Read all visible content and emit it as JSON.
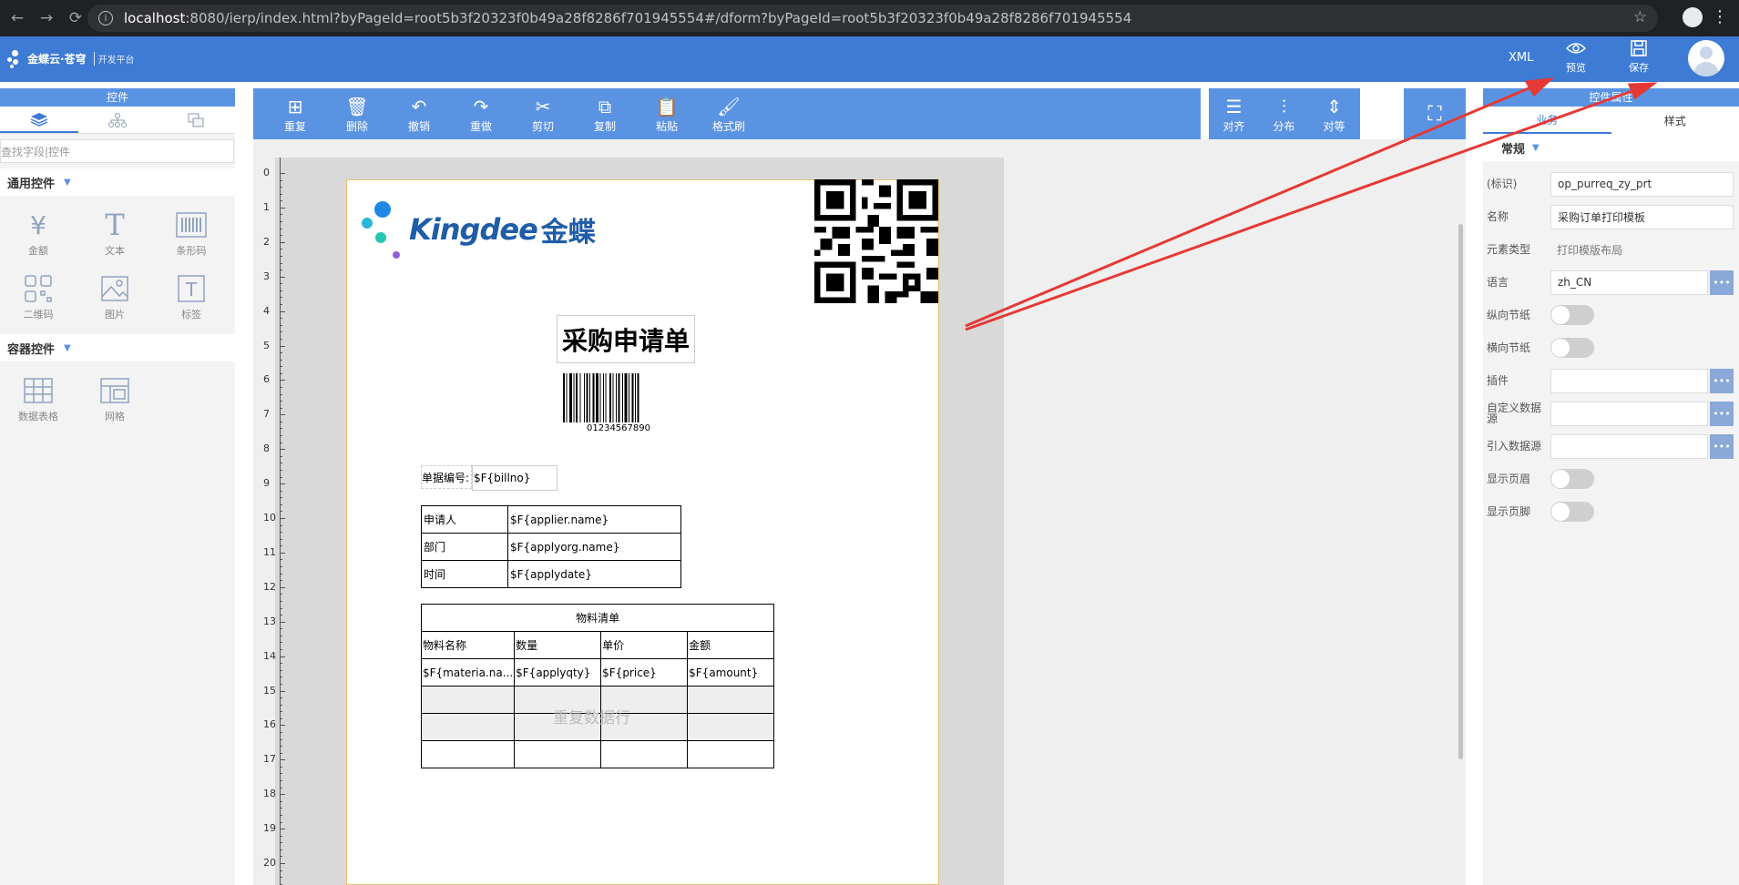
{
  "browser": {
    "url_host": "localhost",
    "url_rest": ":8080/ierp/index.html?byPageId=root5b3f20323f0b49a28f8286f701945554#/dform?byPageId=root5b3f20323f0b49a28f8286f701945554"
  },
  "header": {
    "logo_text": "金蝶云·苍穹",
    "logo_sub": "开发平台",
    "xml_label": "XML",
    "preview_label": "预览",
    "save_label": "保存"
  },
  "left_panel": {
    "title": "控件",
    "search_placeholder": "查找字段|控件",
    "general_section": "通用控件",
    "container_section": "容器控件",
    "general_widgets": [
      "金额",
      "文本",
      "条形码",
      "二维码",
      "图片",
      "标签"
    ],
    "container_widgets": [
      "数据表格",
      "网格"
    ]
  },
  "toolbar": {
    "buttons": [
      "重复",
      "删除",
      "撤销",
      "重做",
      "剪切",
      "复制",
      "粘贴",
      "格式刷"
    ],
    "align_buttons": [
      "对齐",
      "分布",
      "对等"
    ]
  },
  "ruler": {
    "ticks": [
      "0",
      "1",
      "2",
      "3",
      "4",
      "5",
      "6",
      "7",
      "8",
      "9",
      "10",
      "11",
      "12",
      "13",
      "14",
      "15",
      "16",
      "17",
      "18",
      "19",
      "20"
    ]
  },
  "document": {
    "logo_brand": "Kingdee",
    "logo_cn": "金蝶",
    "title": "采购申请单",
    "barcode_number": "01234567890",
    "billno_label": "单据编号:",
    "billno_value": "$F{billno}",
    "info_rows": [
      {
        "label": "申请人",
        "value": "$F{applier.name}"
      },
      {
        "label": "部门",
        "value": "$F{applyorg.name}"
      },
      {
        "label": "时间",
        "value": "$F{applydate}"
      }
    ],
    "material_table": {
      "title": "物料清单",
      "headers": [
        "物料名称",
        "数量",
        "单价",
        "金额"
      ],
      "row": [
        "$F{materia.na...",
        "$F{applyqty}",
        "$F{price}",
        "$F{amount}"
      ],
      "repeat_label": "重复数据行"
    }
  },
  "right_panel": {
    "title": "控件属性",
    "tabs": [
      "业务",
      "样式"
    ],
    "section": "常规",
    "props": {
      "id_label": "(标识)",
      "id_value": "op_purreq_zy_prt",
      "name_label": "名称",
      "name_value": "采购订单打印模板",
      "type_label": "元素类型",
      "type_value": "打印模版布局",
      "lang_label": "语言",
      "lang_value": "zh_CN",
      "vertical_label": "纵向节纸",
      "horizontal_label": "横向节纸",
      "plugin_label": "插件",
      "custom_ds_label": "自定义数据源",
      "ref_ds_label": "引入数据源",
      "show_header_label": "显示页眉",
      "show_footer_label": "显示页脚"
    }
  },
  "colors": {
    "header_blue": "#3d7bd4",
    "toolbar_blue": "#5b93e3",
    "arrow_red": "#e53935"
  }
}
